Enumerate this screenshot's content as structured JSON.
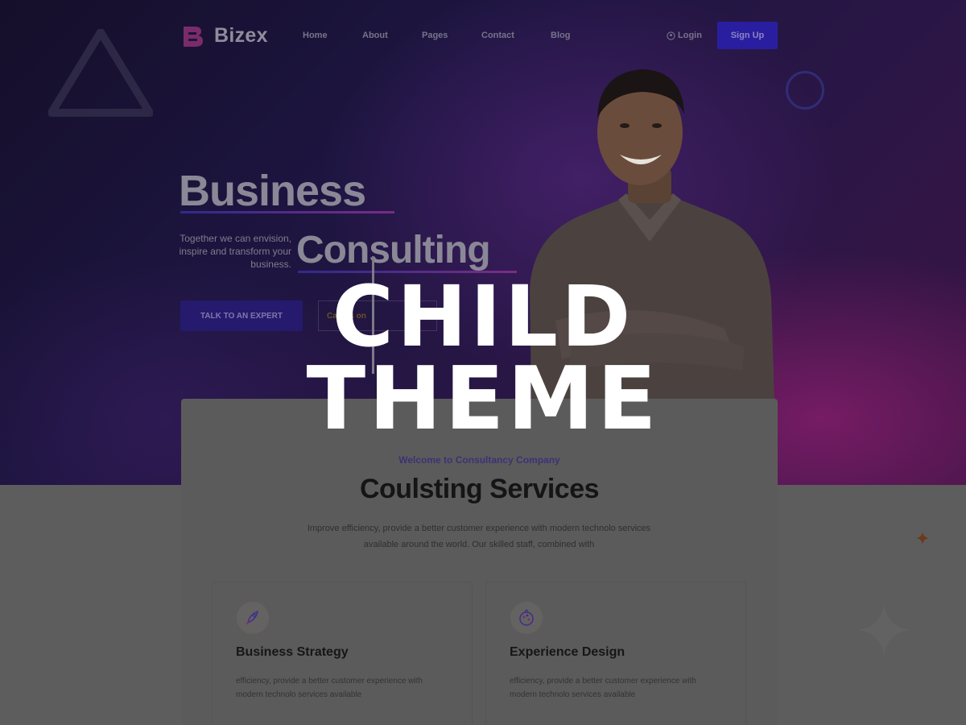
{
  "brand": {
    "name": "Bizex",
    "accent": "#2a1ea0",
    "secondary_accent": "#7a2c86"
  },
  "nav": {
    "items": [
      "Home",
      "About",
      "Pages",
      "Contact",
      "Blog"
    ],
    "login_label": "Login",
    "signup_label": "Sign Up"
  },
  "hero": {
    "headline_line1": "Business",
    "headline_line2": "Consulting",
    "tagline": "Together we can envision, inspire and transform your business.",
    "cta_primary": "TALK TO AN EXPERT",
    "cta_secondary": "Call Us on"
  },
  "services": {
    "welcome": "Welcome to Consultancy Company",
    "title": "Coulsting Services",
    "description": "Improve efficiency, provide a better customer experience with modern technolo services available around the world. Our skilled staff, combined with",
    "cards": [
      {
        "icon": "rocket-icon",
        "title": "Business Strategy",
        "description": "efficiency, provide a better customer experience with modern technolo services available"
      },
      {
        "icon": "palette-icon",
        "title": "Experience Design",
        "description": "efficiency, provide a better customer experience with modern technolo services available"
      }
    ]
  },
  "overlay": {
    "line1": "CHILD",
    "line2": "THEME"
  }
}
